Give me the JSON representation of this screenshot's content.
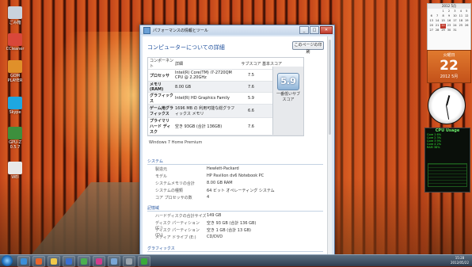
{
  "desktop": {
    "icons": [
      {
        "label": "ごみ箱",
        "color": "#c9d3dd"
      },
      {
        "label": "CCleaner",
        "color": "#d9473a"
      },
      {
        "label": "GOM PLAYER",
        "color": "#e0902a"
      },
      {
        "label": "Skype",
        "color": "#1ea7e1"
      },
      {
        "label": "GPU-Z 0.5.7",
        "color": "#3d8f3d"
      },
      {
        "label": "WEI",
        "color": "#e8e8e8"
      }
    ]
  },
  "window": {
    "title": "パフォーマンスの情報とツール",
    "heading": "コンピューターについての詳細",
    "print_button": "このページの印刷",
    "table": {
      "headers": [
        "コンポーネント",
        "詳細",
        "サブスコア",
        "基本スコア"
      ],
      "rows": [
        {
          "component": "プロセッサ",
          "detail": "Intel(R) Core(TM) i7-2720QM CPU @ 2.20GHz",
          "score": "7.5"
        },
        {
          "component": "メモリ (RAM)",
          "detail": "8.00 GB",
          "score": "7.6"
        },
        {
          "component": "グラフィックス",
          "detail": "Intel(R) HD Graphics Family",
          "score": "5.9"
        },
        {
          "component": "ゲーム用グラフィックス",
          "detail": "1696 MB の 利用可能な総グラフィックス メモリ",
          "score": "6.6"
        },
        {
          "component": "プライマリ ハード ディスク",
          "detail": "空き 93GB (合計 136GB)",
          "score": "7.6"
        }
      ],
      "base_score": "5.9",
      "base_caption": "一番低いサブスコア"
    },
    "edition": "Windows 7 Home Premium",
    "system_section": "システム",
    "system": [
      {
        "k": "製造元",
        "v": "Hewlett-Packard"
      },
      {
        "k": "モデル",
        "v": "HP Pavilion dv6 Notebook PC"
      },
      {
        "k": "システムメモリの合計",
        "v": "8.00 GB RAM"
      },
      {
        "k": "システムの種類",
        "v": "64 ビット オペレーティング システム"
      },
      {
        "k": "コア プロセッサの数",
        "v": "4"
      }
    ],
    "storage_section": "記憶域",
    "storage": [
      {
        "k": "ハードディスクの合計サイズ",
        "v": "149 GB"
      },
      {
        "k": "ディスク パーティション (C:)",
        "v": "空き 93 GB (合計 136 GB)"
      },
      {
        "k": "ディスク パーティション (D:)",
        "v": "空き 1 GB (合計 13 GB)"
      },
      {
        "k": "メディア ドライブ (E:)",
        "v": "CD/DVD"
      }
    ],
    "graphics_section": "グラフィックス"
  },
  "gadgets": {
    "calendar_header": "2012 5月",
    "calendar_days": [
      "",
      "",
      "1",
      "2",
      "3",
      "4",
      "5",
      "6",
      "7",
      "8",
      "9",
      "10",
      "11",
      "12",
      "13",
      "14",
      "15",
      "16",
      "17",
      "18",
      "19",
      "20",
      "21",
      "22",
      "23",
      "24",
      "25",
      "26",
      "27",
      "28",
      "29",
      "30",
      "31",
      "",
      ""
    ],
    "today": "22",
    "date_dow": "火曜日",
    "date_day": "22",
    "date_ym": "2012 5月",
    "cpu_title": "CPU Usage",
    "cpu_rows": [
      "Core 1  6%",
      "Core 2  3%",
      "Core 3  9%",
      "Core 4  2%",
      "RAM  38%"
    ]
  },
  "taskbar": {
    "time": "15:28",
    "date": "2012/05/22",
    "apps": [
      {
        "name": "ie",
        "color": "#3b8fd8"
      },
      {
        "name": "firefox",
        "color": "#e8652b"
      },
      {
        "name": "explorer",
        "color": "#f0c94a"
      },
      {
        "name": "media",
        "color": "#3a6fd0"
      },
      {
        "name": "chrome",
        "color": "#4caf50"
      },
      {
        "name": "msn",
        "color": "#d23c8c"
      },
      {
        "name": "perf",
        "color": "#7aa7d6"
      },
      {
        "name": "tools",
        "color": "#9aa4ad"
      },
      {
        "name": "cpu",
        "color": "#3aaa3a"
      }
    ]
  }
}
